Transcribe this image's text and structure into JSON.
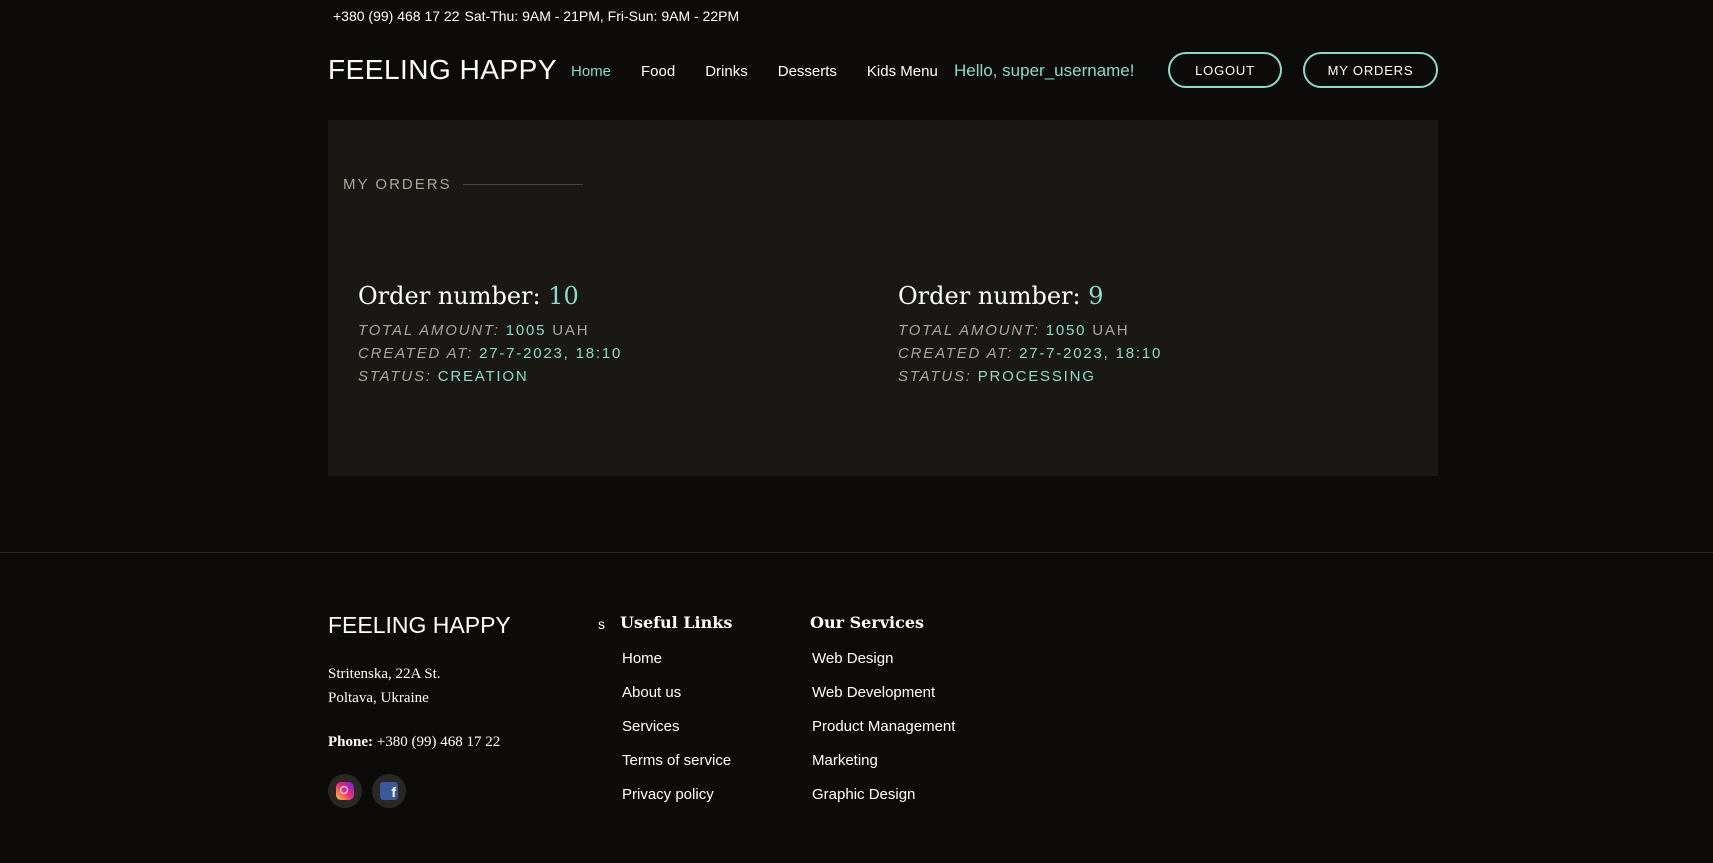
{
  "topbar": {
    "phone": "+380 (99) 468 17 22",
    "hours": "Sat-Thu: 9AM - 21PM, Fri-Sun: 9AM - 22PM"
  },
  "header": {
    "logo": "FEELING HAPPY",
    "nav": [
      "Home",
      "Food",
      "Drinks",
      "Desserts",
      "Kids Menu"
    ],
    "active_nav": "Home",
    "greeting": "Hello, super_username!",
    "logout_label": "LOGOUT",
    "orders_label": "MY ORDERS"
  },
  "main": {
    "section_title": "MY ORDERS",
    "orders": [
      {
        "title_label": "Order number: ",
        "number": "10",
        "amount_label": "TOTAL AMOUNT: ",
        "amount": "1005",
        "currency": " UAH",
        "created_label": "CREATED AT: ",
        "created": "27-7-2023, 18:10",
        "status_label": "STATUS: ",
        "status": "CREATION"
      },
      {
        "title_label": "Order number: ",
        "number": "9",
        "amount_label": "TOTAL AMOUNT: ",
        "amount": "1050",
        "currency": " UAH",
        "created_label": "CREATED AT: ",
        "created": "27-7-2023, 18:10",
        "status_label": "STATUS: ",
        "status": "PROCESSING"
      }
    ]
  },
  "footer": {
    "logo": "FEELING HAPPY",
    "address_line1": "Stritenska, 22A St.",
    "address_line2": "Poltava, Ukraine",
    "phone_label": "Phone:",
    "phone": " +380 (99) 468 17 22",
    "stray_char": "s",
    "useful_links_title": "Useful Links",
    "useful_links": [
      "Home",
      "About us",
      "Services",
      "Terms of service",
      "Privacy policy"
    ],
    "services_title": "Our Services",
    "services": [
      "Web Design",
      "Web Development",
      "Product Management",
      "Marketing",
      "Graphic Design"
    ],
    "social_icons": [
      "instagram-icon",
      "facebook-icon"
    ],
    "fb_glyph": "f"
  },
  "colors": {
    "background": "#0c0b09",
    "panel": "#1a1814",
    "accent": "#8fd9cb",
    "muted": "#aaa59a"
  }
}
